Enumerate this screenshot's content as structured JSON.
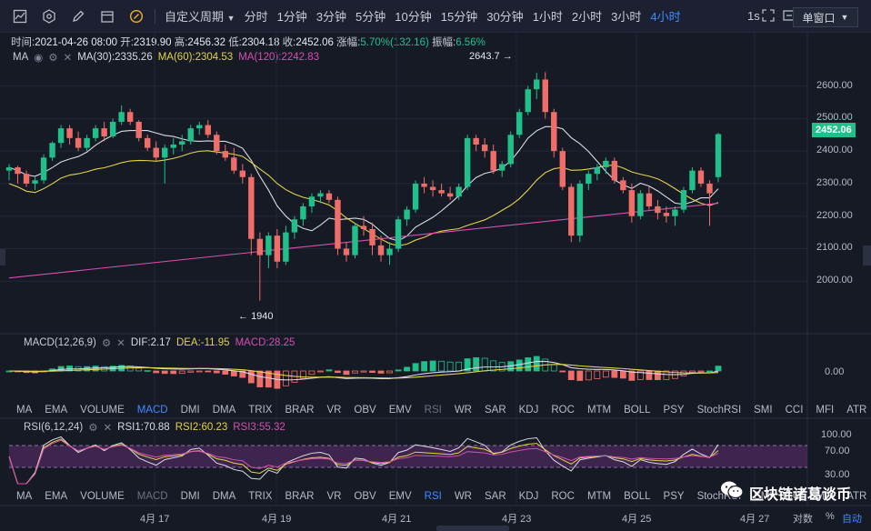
{
  "toolbar": {
    "period_dropdown": "自定义周期",
    "periods": [
      "分时",
      "1分钟",
      "3分钟",
      "5分钟",
      "10分钟",
      "15分钟",
      "30分钟",
      "1小时",
      "2小时",
      "3小时",
      "4小时"
    ],
    "active_period": "4小时",
    "seconds_label": "1s",
    "window_mode": "单窗口"
  },
  "info": {
    "time_label": "时间:",
    "time": "2021-04-26 08:00",
    "open_label": "开:",
    "open": "2319.90",
    "high_label": "高:",
    "high": "2456.32",
    "low_label": "低:",
    "low": "2304.18",
    "close_label": "收:",
    "close": "2452.06",
    "change_label": "涨幅:",
    "change": "5.70%(132.16)",
    "amp_label": "振幅:",
    "amp": "6.56%"
  },
  "ma_legend": {
    "name": "MA",
    "ma30": "MA(30):2335.26",
    "ma60": "MA(60):2304.53",
    "ma120": "MA(120):2242.83",
    "colors": {
      "ma30": "#d8dbe3",
      "ma60": "#e3d24a",
      "ma120": "#d64fb0"
    }
  },
  "macd_legend": {
    "name": "MACD(12,26,9)",
    "dif": "DIF:2.17",
    "dea": "DEA:-11.95",
    "macd": "MACD:28.25"
  },
  "rsi_legend": {
    "name": "RSI(6,12,24)",
    "rsi1": "RSI1:70.88",
    "rsi2": "RSI2:60.23",
    "rsi3": "RSI3:55.32"
  },
  "indicator_tabs": [
    "MA",
    "EMA",
    "VOLUME",
    "MACD",
    "DMI",
    "DMA",
    "TRIX",
    "BRAR",
    "VR",
    "OBV",
    "EMV",
    "RSI",
    "WR",
    "SAR",
    "KDJ",
    "ROC",
    "MTM",
    "BOLL",
    "PSY",
    "StochRSI",
    "SMI",
    "CCI",
    "MFI",
    "ATR"
  ],
  "active_tab_1": "MACD",
  "active_tab_2": "RSI",
  "price_axis": [
    "2600.00",
    "2500.00",
    "2400.00",
    "2300.00",
    "2200.00",
    "2100.00",
    "2000.00"
  ],
  "current_price": "2452.06",
  "high_annotation": "2643.7",
  "low_annotation": "1940",
  "macd_axis": "0.00",
  "rsi_axis": [
    "100.00",
    "70.00",
    "30.00"
  ],
  "date_axis": [
    "4月 17",
    "4月 19",
    "4月 21",
    "4月 23",
    "4月 25",
    "4月 27"
  ],
  "bottom_right": {
    "log": "对数",
    "pct": "%",
    "auto": "自动"
  },
  "watermark": "区块链诸葛谈币",
  "colors": {
    "up": "#21c08b",
    "down": "#ef6e6a",
    "accent": "#3f8cff"
  },
  "chart_data": {
    "type": "candlestick",
    "ylim": [
      1900,
      2680
    ],
    "candles": [
      [
        2340,
        2360,
        2310,
        2350
      ],
      [
        2350,
        2355,
        2300,
        2330
      ],
      [
        2330,
        2340,
        2290,
        2300
      ],
      [
        2300,
        2320,
        2280,
        2310
      ],
      [
        2310,
        2390,
        2300,
        2380
      ],
      [
        2380,
        2430,
        2370,
        2425
      ],
      [
        2425,
        2480,
        2410,
        2470
      ],
      [
        2470,
        2480,
        2420,
        2440
      ],
      [
        2440,
        2460,
        2400,
        2410
      ],
      [
        2410,
        2450,
        2400,
        2440
      ],
      [
        2440,
        2480,
        2430,
        2470
      ],
      [
        2470,
        2490,
        2430,
        2445
      ],
      [
        2445,
        2500,
        2440,
        2490
      ],
      [
        2490,
        2540,
        2480,
        2520
      ],
      [
        2520,
        2530,
        2480,
        2490
      ],
      [
        2490,
        2495,
        2430,
        2440
      ],
      [
        2440,
        2450,
        2400,
        2410
      ],
      [
        2410,
        2430,
        2370,
        2380
      ],
      [
        2380,
        2420,
        2300,
        2410
      ],
      [
        2410,
        2440,
        2390,
        2420
      ],
      [
        2420,
        2450,
        2400,
        2430
      ],
      [
        2430,
        2480,
        2420,
        2470
      ],
      [
        2470,
        2490,
        2450,
        2480
      ],
      [
        2480,
        2495,
        2440,
        2450
      ],
      [
        2450,
        2460,
        2390,
        2400
      ],
      [
        2400,
        2420,
        2370,
        2380
      ],
      [
        2380,
        2410,
        2330,
        2340
      ],
      [
        2340,
        2360,
        2300,
        2320
      ],
      [
        2320,
        2330,
        2080,
        2130
      ],
      [
        2130,
        2150,
        1940,
        2080
      ],
      [
        2080,
        2150,
        2040,
        2140
      ],
      [
        2140,
        2160,
        2040,
        2060
      ],
      [
        2060,
        2170,
        2050,
        2150
      ],
      [
        2150,
        2200,
        2130,
        2190
      ],
      [
        2190,
        2240,
        2170,
        2230
      ],
      [
        2230,
        2270,
        2210,
        2260
      ],
      [
        2260,
        2280,
        2240,
        2270
      ],
      [
        2270,
        2280,
        2240,
        2250
      ],
      [
        2250,
        2260,
        2080,
        2100
      ],
      [
        2100,
        2120,
        2060,
        2080
      ],
      [
        2080,
        2180,
        2070,
        2170
      ],
      [
        2170,
        2200,
        2140,
        2160
      ],
      [
        2160,
        2180,
        2080,
        2110
      ],
      [
        2110,
        2140,
        2060,
        2080
      ],
      [
        2080,
        2120,
        2050,
        2100
      ],
      [
        2100,
        2200,
        2090,
        2190
      ],
      [
        2190,
        2230,
        2170,
        2220
      ],
      [
        2220,
        2310,
        2210,
        2300
      ],
      [
        2300,
        2320,
        2270,
        2290
      ],
      [
        2290,
        2310,
        2260,
        2280
      ],
      [
        2280,
        2300,
        2260,
        2270
      ],
      [
        2270,
        2290,
        2250,
        2260
      ],
      [
        2260,
        2300,
        2250,
        2290
      ],
      [
        2290,
        2450,
        2280,
        2440
      ],
      [
        2440,
        2450,
        2400,
        2420
      ],
      [
        2420,
        2440,
        2380,
        2400
      ],
      [
        2400,
        2420,
        2330,
        2340
      ],
      [
        2340,
        2370,
        2320,
        2360
      ],
      [
        2360,
        2460,
        2350,
        2450
      ],
      [
        2450,
        2530,
        2440,
        2520
      ],
      [
        2520,
        2600,
        2510,
        2590
      ],
      [
        2590,
        2640,
        2560,
        2620
      ],
      [
        2620,
        2643,
        2500,
        2520
      ],
      [
        2520,
        2530,
        2380,
        2400
      ],
      [
        2400,
        2410,
        2280,
        2290
      ],
      [
        2290,
        2300,
        2120,
        2140
      ],
      [
        2140,
        2310,
        2120,
        2300
      ],
      [
        2300,
        2340,
        2280,
        2330
      ],
      [
        2330,
        2360,
        2310,
        2350
      ],
      [
        2350,
        2380,
        2330,
        2370
      ],
      [
        2370,
        2380,
        2300,
        2310
      ],
      [
        2310,
        2320,
        2270,
        2280
      ],
      [
        2280,
        2300,
        2180,
        2200
      ],
      [
        2200,
        2280,
        2190,
        2270
      ],
      [
        2270,
        2290,
        2220,
        2230
      ],
      [
        2230,
        2250,
        2190,
        2210
      ],
      [
        2210,
        2230,
        2180,
        2200
      ],
      [
        2200,
        2230,
        2170,
        2220
      ],
      [
        2220,
        2290,
        2210,
        2280
      ],
      [
        2280,
        2350,
        2270,
        2340
      ],
      [
        2340,
        2350,
        2290,
        2300
      ],
      [
        2300,
        2310,
        2170,
        2270
      ],
      [
        2319.9,
        2456.32,
        2304.18,
        2452.06
      ]
    ]
  }
}
